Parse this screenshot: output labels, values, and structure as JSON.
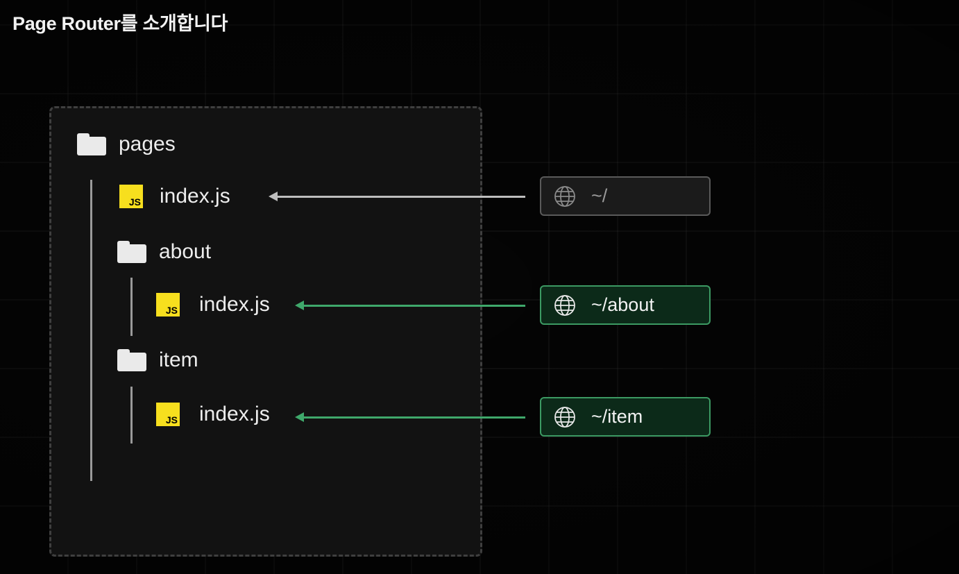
{
  "title": "Page Router를 소개합니다",
  "tree": {
    "root": {
      "label": "pages",
      "icon": "folder-icon"
    },
    "items": [
      {
        "label": "index.js",
        "icon": "js-file-icon"
      },
      {
        "label": "about",
        "icon": "folder-icon"
      },
      {
        "label": "index.js",
        "icon": "js-file-icon"
      },
      {
        "label": "item",
        "icon": "folder-icon"
      },
      {
        "label": "index.js",
        "icon": "js-file-icon"
      }
    ],
    "js_badge": "JS"
  },
  "routes": [
    {
      "path": "~/",
      "icon": "globe-icon",
      "style": "neutral"
    },
    {
      "path": "~/about",
      "icon": "globe-icon",
      "style": "green"
    },
    {
      "path": "~/item",
      "icon": "globe-icon",
      "style": "green"
    }
  ],
  "colors": {
    "background": "#050505",
    "panel": "#121212",
    "neutral_arrow": "#bdbdbd",
    "green_arrow": "#3fa86b",
    "green_box_bg": "#0c2a19",
    "green_box_border": "#3c9a63",
    "neutral_box_bg": "#1b1b1b",
    "neutral_box_border": "#5a5a5a",
    "js_yellow": "#f7df1e"
  }
}
